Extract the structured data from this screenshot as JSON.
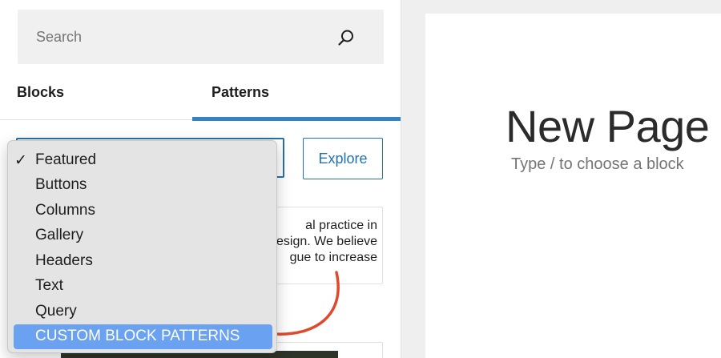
{
  "search": {
    "placeholder": "Search"
  },
  "tabs": [
    {
      "label": "Blocks"
    },
    {
      "label": "Patterns"
    }
  ],
  "explore_label": "Explore",
  "category_menu": {
    "selected": "Featured",
    "items": [
      {
        "label": "Featured",
        "checked": true
      },
      {
        "label": "Buttons"
      },
      {
        "label": "Columns"
      },
      {
        "label": "Gallery"
      },
      {
        "label": "Headers"
      },
      {
        "label": "Text"
      },
      {
        "label": "Query"
      },
      {
        "label": "CUSTOM BLOCK PATTERNS",
        "highlighted": true
      }
    ]
  },
  "pattern_preview": {
    "text": "al practice in\nesign. We believe\ngue to increase"
  },
  "editor": {
    "title": "New Page",
    "placeholder": "Type / to choose a block"
  },
  "colors": {
    "accent": "#3582c4",
    "highlight": "#6aa1f0",
    "annotation": "#e04a2c"
  }
}
